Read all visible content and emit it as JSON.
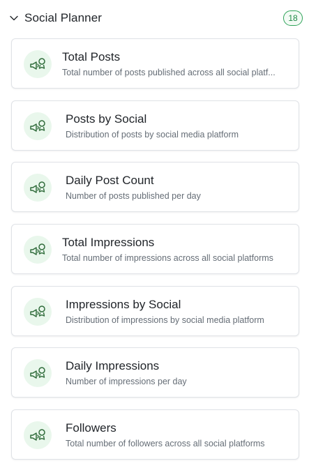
{
  "section": {
    "title": "Social Planner",
    "count": "18",
    "expanded": true
  },
  "colors": {
    "accent": "#2ea358",
    "icon_bg": "#e9f7ec",
    "card_border": "#dfe2e6",
    "muted_text": "#656d76"
  },
  "cards": [
    {
      "title": "Total Posts",
      "description": "Total number of posts published across all social platf...",
      "icon": "megaphone-badge-icon"
    },
    {
      "title": "Posts by Social",
      "description": "Distribution of posts by social media platform",
      "icon": "megaphone-badge-icon"
    },
    {
      "title": "Daily Post Count",
      "description": "Number of posts published per day",
      "icon": "megaphone-badge-icon"
    },
    {
      "title": "Total Impressions",
      "description": "Total number of impressions across all social platforms",
      "icon": "megaphone-badge-icon"
    },
    {
      "title": "Impressions by Social",
      "description": "Distribution of impressions by social media platform",
      "icon": "megaphone-badge-icon"
    },
    {
      "title": "Daily Impressions",
      "description": "Number of impressions per day",
      "icon": "megaphone-badge-icon"
    },
    {
      "title": "Followers",
      "description": "Total number of followers across all social platforms",
      "icon": "megaphone-badge-icon"
    }
  ]
}
